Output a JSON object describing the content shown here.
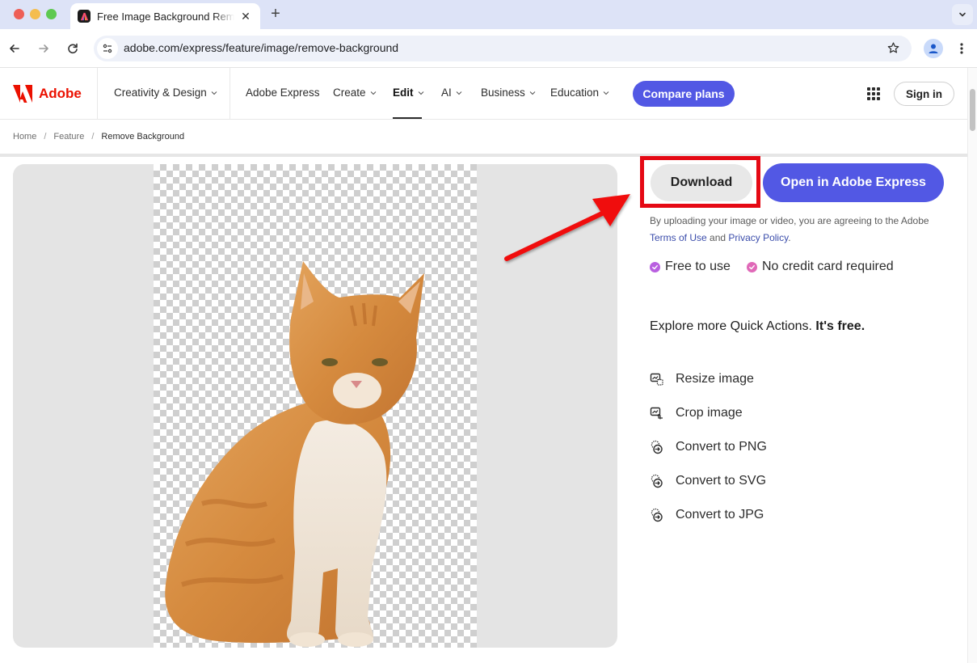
{
  "browser": {
    "tab": {
      "title": "Free Image Background Remover",
      "favicon": "adobe-express-favicon",
      "close_icon": "close-icon"
    },
    "new_tab_icon": "plus-icon",
    "tab_menu_icon": "chevron-down-icon",
    "nav": {
      "back": "arrow-left-icon",
      "forward": "arrow-right-icon",
      "reload": "reload-icon"
    },
    "url": "adobe.com/express/feature/image/remove-background",
    "site_info_icon": "tune-icon",
    "bookmark_icon": "star-icon",
    "profile_icon": "person-icon",
    "menu_icon": "kebab-icon"
  },
  "header": {
    "brand": "Adobe",
    "nav_items": [
      {
        "label": "Creativity & Design",
        "dropdown": true
      },
      {
        "label": "Adobe Express",
        "dropdown": false
      },
      {
        "label": "Create",
        "dropdown": true
      },
      {
        "label": "Edit",
        "dropdown": true,
        "active": true
      },
      {
        "label": "AI",
        "dropdown": true
      },
      {
        "label": "Business",
        "dropdown": true
      },
      {
        "label": "Education",
        "dropdown": true
      }
    ],
    "cta": "Compare plans",
    "apps_icon": "app-grid-icon",
    "sign_in": "Sign in"
  },
  "breadcrumb": {
    "items": [
      "Home",
      "Feature",
      "Remove Background"
    ],
    "separator": "/"
  },
  "preview": {
    "subject": "Orange tabby cat with background removed (transparent checkerboard)"
  },
  "panel": {
    "download": "Download",
    "open_in_express": "Open in Adobe Express",
    "legal_prefix": "By uploading your image or video, you are agreeing to the Adobe",
    "terms_link": "Terms of Use",
    "legal_and": "and",
    "privacy_link": "Privacy Policy",
    "legal_suffix": ".",
    "perks": [
      {
        "label": "Free to use",
        "color": "#b95fe0"
      },
      {
        "label": "No credit card required",
        "color": "#e069b8"
      }
    ],
    "explore_text": "Explore more Quick Actions.",
    "explore_bold": "It's free.",
    "quick_actions": [
      {
        "label": "Resize image",
        "icon": "resize-image-icon"
      },
      {
        "label": "Crop image",
        "icon": "crop-image-icon"
      },
      {
        "label": "Convert to PNG",
        "icon": "convert-icon"
      },
      {
        "label": "Convert to SVG",
        "icon": "convert-icon"
      },
      {
        "label": "Convert to JPG",
        "icon": "convert-icon"
      }
    ]
  },
  "annotation": {
    "highlight_color": "#e50914",
    "target": "Download"
  },
  "colors": {
    "accent": "#5258e4",
    "adobe_red": "#eb1000",
    "link": "#3b4dab"
  }
}
